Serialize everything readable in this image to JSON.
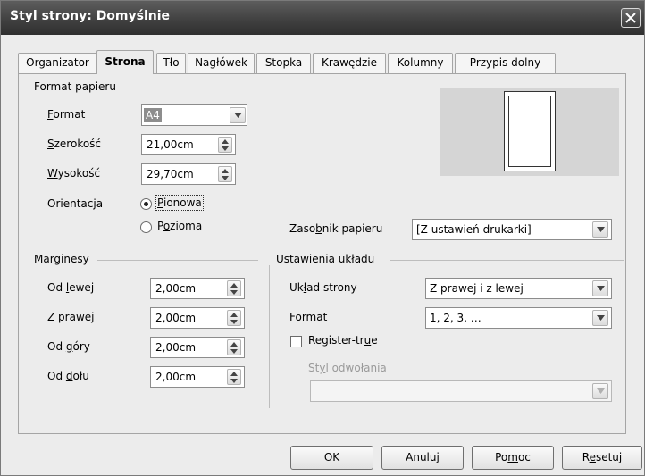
{
  "window": {
    "title": "Styl strony: Domyślnie"
  },
  "tabs": [
    {
      "label": "Organizator"
    },
    {
      "label": "Strona"
    },
    {
      "label": "Tło"
    },
    {
      "label": "Nagłówek"
    },
    {
      "label": "Stopka"
    },
    {
      "label": "Krawędzie"
    },
    {
      "label": "Kolumny"
    },
    {
      "label": "Przypis dolny"
    }
  ],
  "paper_format": {
    "section_title": "Format papieru",
    "format_label": {
      "ul": "F",
      "rest": "ormat"
    },
    "format_value": "A4",
    "width_label": {
      "ul": "S",
      "rest": "zerokość"
    },
    "width_value": "21,00cm",
    "height_label": {
      "ul": "W",
      "rest": "ysokość"
    },
    "height_value": "29,70cm",
    "orientation_label": "Orientacja",
    "portrait": {
      "ul": "P",
      "rest": "ionowa",
      "checked": true
    },
    "landscape": {
      "pre": "P",
      "ul": "o",
      "rest": "zioma",
      "checked": false
    },
    "tray_label": {
      "pre": "Zaso",
      "ul": "b",
      "rest": "nik papieru"
    },
    "tray_value": "[Z ustawień drukarki]"
  },
  "margins": {
    "section_title": "Marginesy",
    "left_label": {
      "pre": "Od ",
      "ul": "l",
      "rest": "ewej"
    },
    "left_value": "2,00cm",
    "right_label": {
      "pre": "Z p",
      "ul": "r",
      "rest": "awej"
    },
    "right_value": "2,00cm",
    "top_label": {
      "pre": "Od ",
      "ul": "g",
      "rest": "óry"
    },
    "top_value": "2,00cm",
    "bottom_label": {
      "pre": "Od ",
      "ul": "d",
      "rest": "ołu"
    },
    "bottom_value": "2,00cm"
  },
  "layout": {
    "section_title": "Ustawienia układu",
    "page_layout_label": {
      "pre": "Uk",
      "ul": "ł",
      "rest": "ad strony"
    },
    "page_layout_value": "Z prawej i z lewej",
    "format_label": {
      "pre": "Forma",
      "ul": "t",
      "rest": ""
    },
    "format_value": "1, 2, 3, …",
    "register_label": {
      "pre": "Register-tr",
      "ul": "u",
      "rest": "e"
    },
    "register_checked": false,
    "ref_style_label": {
      "pre": "St",
      "ul": "y",
      "rest": "l odwołania"
    },
    "ref_style_value": ""
  },
  "buttons": {
    "ok": "OK",
    "cancel": "Anuluj",
    "help": {
      "pre": "Po",
      "ul": "m",
      "rest": "oc"
    },
    "reset": {
      "pre": "R",
      "ul": "e",
      "rest": "setuj"
    }
  },
  "colors": {
    "titlebar": "#3f3f3f",
    "dialog_bg": "#ececec",
    "preview_bg": "#d5d5d5",
    "highlight": "#8d8d8d"
  }
}
